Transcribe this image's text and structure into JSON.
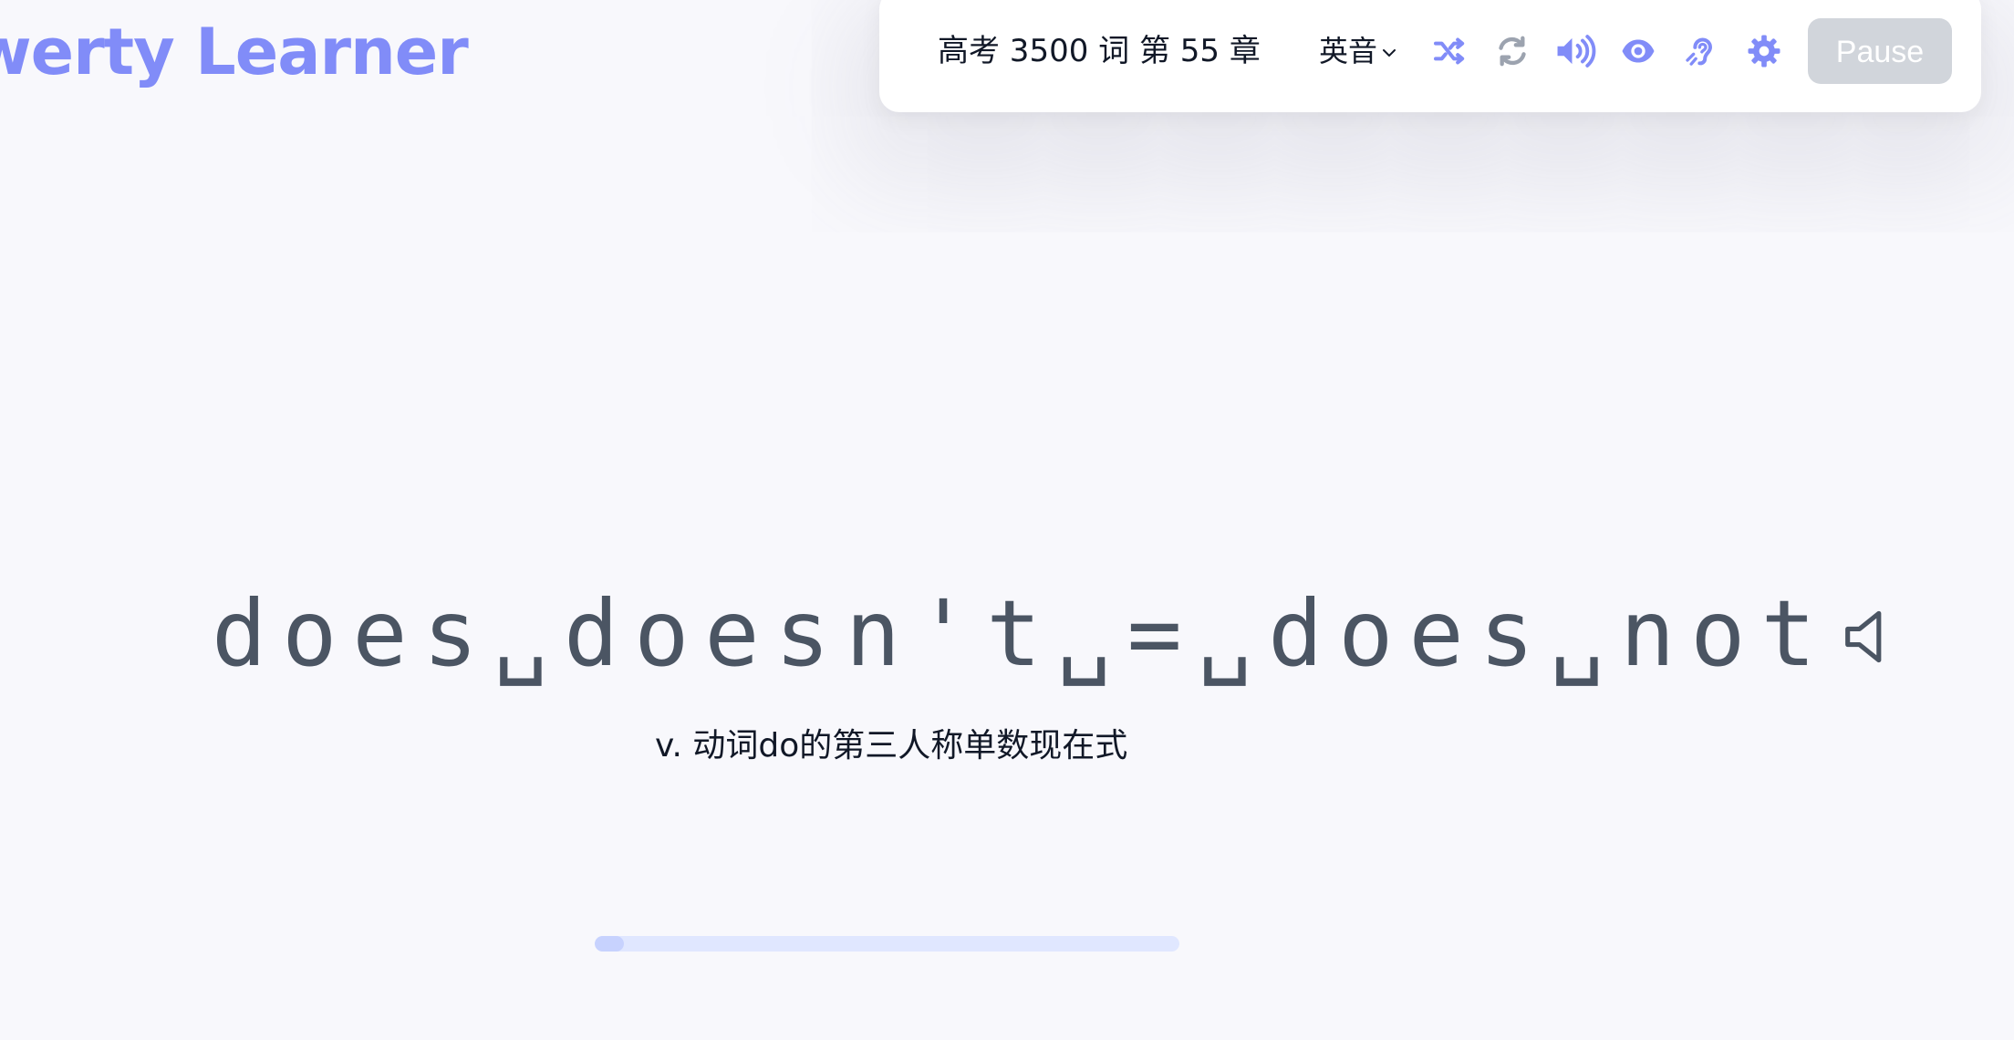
{
  "app": {
    "logo_text": "werty Learner",
    "accent_color": "#818cf8"
  },
  "toolbar": {
    "dictionary_chapter": "高考 3500 词 第 55 章",
    "pronunciation_label": "英音",
    "pause_label": "Pause",
    "icons": [
      "shuffle-icon",
      "loop-icon",
      "volume-icon",
      "eye-icon",
      "hearing-icon",
      "settings-icon"
    ]
  },
  "word": {
    "text": "does␣doesn't␣=␣does␣not",
    "translation": "v. 动词do的第三人称单数现在式"
  },
  "progress": {
    "value_fraction": 0.05
  }
}
